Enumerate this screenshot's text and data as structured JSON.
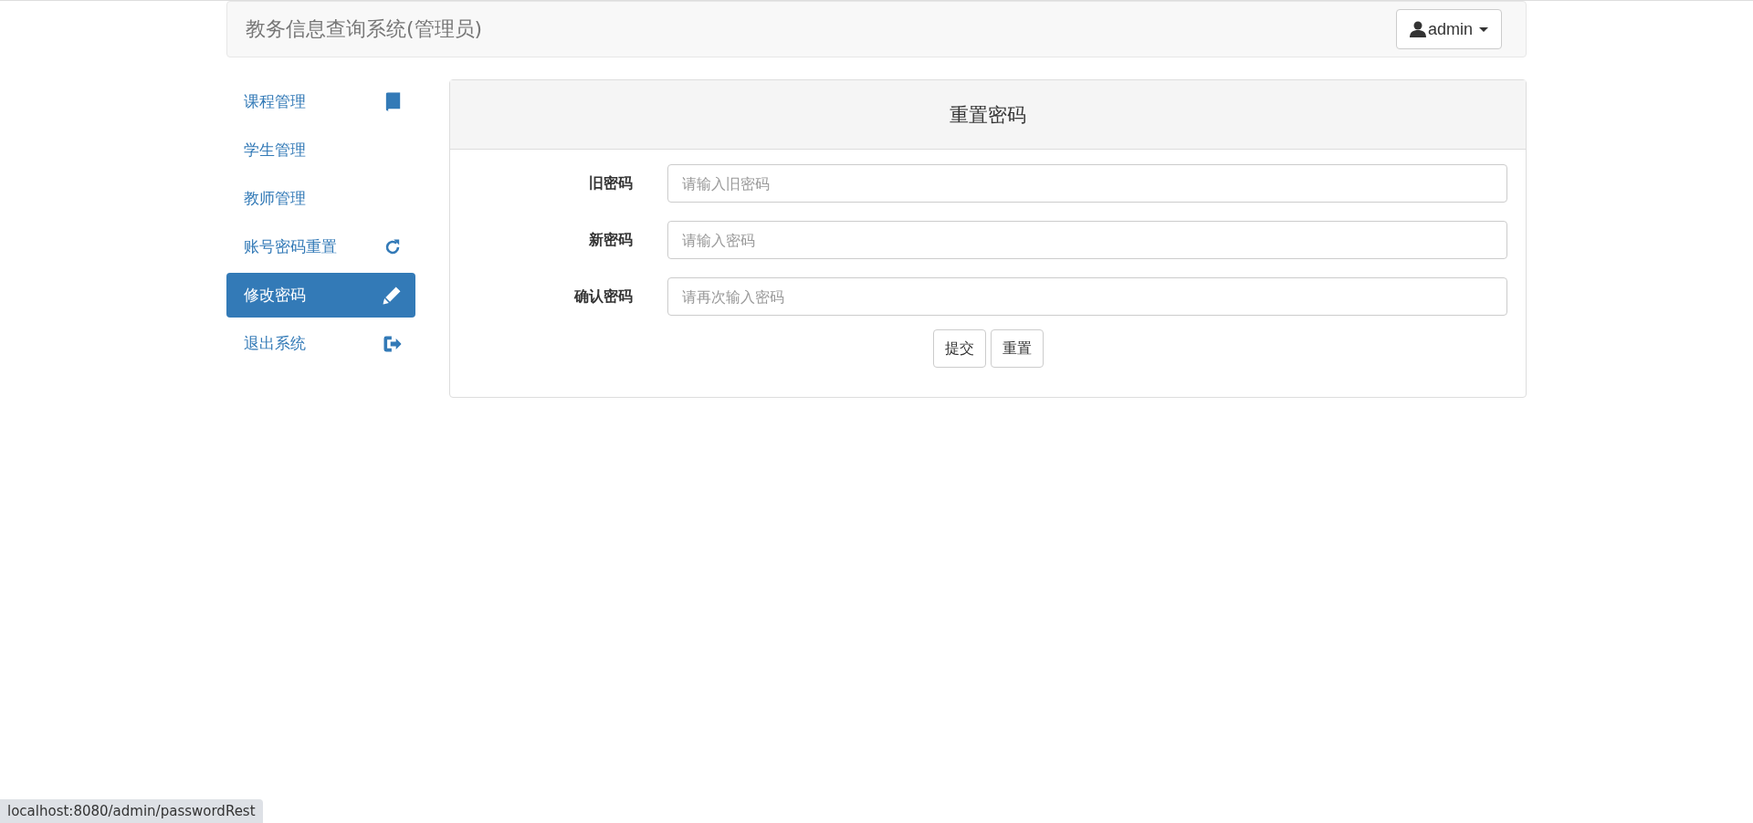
{
  "navbar": {
    "brand": "教务信息查询系统(管理员)",
    "user_menu": "admin"
  },
  "sidebar": {
    "items": [
      {
        "label": "课程管理",
        "selected": false
      },
      {
        "label": "学生管理",
        "selected": false
      },
      {
        "label": "教师管理",
        "selected": false
      },
      {
        "label": "账号密码重置",
        "selected": false
      },
      {
        "label": "修改密码",
        "selected": true
      },
      {
        "label": "退出系统",
        "selected": false
      }
    ]
  },
  "panel": {
    "title": "重置密码",
    "fields": [
      {
        "label": "旧密码",
        "placeholder": "请输入旧密码"
      },
      {
        "label": "新密码",
        "placeholder": "请输入密码"
      },
      {
        "label": "确认密码",
        "placeholder": "请再次输入密码"
      }
    ],
    "buttons": [
      "提交",
      "重置"
    ]
  },
  "status_bar": {
    "url": "localhost:8080/admin/passwordRest"
  }
}
